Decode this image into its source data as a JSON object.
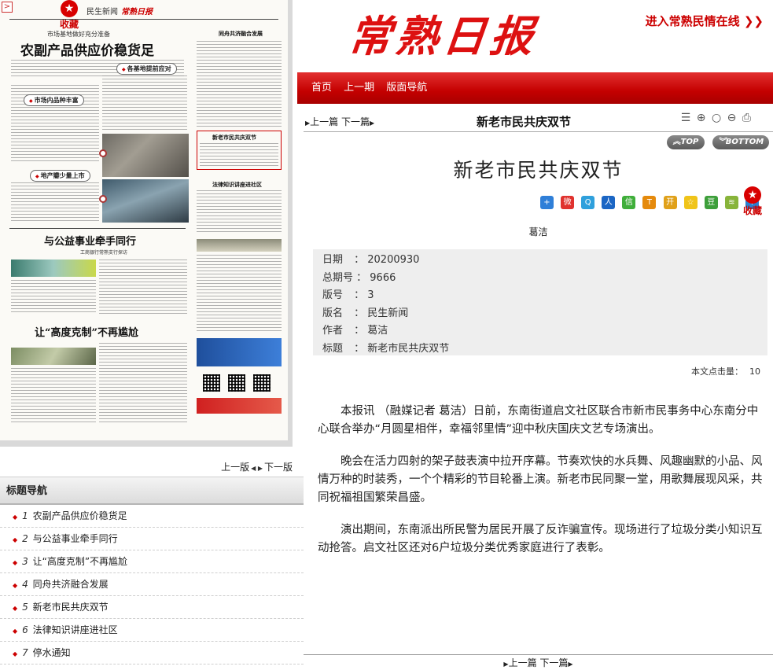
{
  "left": {
    "newspaper": {
      "favorite_label": "收藏",
      "section": "民生新闻",
      "masthead": "常熟日报",
      "headline_main": "农副产品供应价稳货足",
      "kicker_main": "市场基地做好充分准备",
      "sub_supply": "各基地提前应对",
      "sub_market": "市场内品种丰富",
      "sub_local": "地产瓣少量上市",
      "headline_charity": "与公益事业牵手同行",
      "kicker_charity": "工商银行常熟支行探访",
      "headline_myopia": "让“高度克制”不再尴尬",
      "headline_tongzhou": "同舟共济融合发展",
      "headline_festival": "新老市民共庆双节",
      "headline_law": "法律知识讲座进社区",
      "headline_water": "停水通知"
    },
    "pager": {
      "prev": "上一版",
      "next": "下一版"
    },
    "topic_nav": {
      "title": "标题导航",
      "items": [
        {
          "num": "1",
          "label": "农副产品供应价稳货足"
        },
        {
          "num": "2",
          "label": "与公益事业牵手同行"
        },
        {
          "num": "3",
          "label": "让“高度克制”不再尴尬"
        },
        {
          "num": "4",
          "label": "同舟共济融合发展"
        },
        {
          "num": "5",
          "label": "新老市民共庆双节"
        },
        {
          "num": "6",
          "label": "法律知识讲座进社区"
        },
        {
          "num": "7",
          "label": "停水通知"
        }
      ]
    }
  },
  "right": {
    "brand": {
      "logo_text": "常熟日报",
      "external_link": "进入常熟民情在线 ❯❯"
    },
    "nav": {
      "home": "首页",
      "prev_issue": "上一期",
      "layout_nav": "版面导航"
    },
    "article_bar": {
      "prev": "上一篇",
      "next": "下一篇",
      "title": "新老市民共庆双节"
    },
    "top_label": "TOP",
    "bottom_label": "BOTTOM",
    "article": {
      "headline": "新老市民共庆双节",
      "favorite_label": "收藏",
      "author_line": "葛洁",
      "meta": [
        {
          "key": "日期",
          "value": "20200930"
        },
        {
          "key": "总期号",
          "value": "9666"
        },
        {
          "key": "版号",
          "value": "3"
        },
        {
          "key": "版名",
          "value": "民生新闻"
        },
        {
          "key": "作者",
          "value": "葛洁"
        },
        {
          "key": "标题",
          "value": "新老市民共庆双节"
        }
      ],
      "hits_label": "本文点击量：",
      "hits_value": "10",
      "paragraphs": [
        "本报讯 （融媒记者 葛洁）日前，东南街道启文社区联合市新市民事务中心东南分中心联合举办“月圆星相伴，幸福邻里情”迎中秋庆国庆文艺专场演出。",
        "晚会在活力四射的架子鼓表演中拉开序幕。节奏欢快的水兵舞、风趣幽默的小品、风情万种的时装秀，一个个精彩的节目轮番上演。新老市民同聚一堂，用歌舞展现风采，共同祝福祖国繁荣昌盛。",
        "演出期间，东南派出所民警为居民开展了反诈骗宣传。现场进行了垃圾分类小知识互动抢答。启文社区还对6户垃圾分类优秀家庭进行了表彰。"
      ]
    },
    "bottom_nav": {
      "prev": "上一篇",
      "next": "下一篇"
    },
    "icons": {
      "tools": [
        "list-icon",
        "zoom-in-icon",
        "zoom-reset-icon",
        "zoom-out-icon",
        "print-icon"
      ],
      "share": [
        "plus-share-icon",
        "weibo-icon",
        "qzone-icon",
        "renren-icon",
        "wechat-icon",
        "tieba-icon",
        "kaixin-icon",
        "star-share-icon",
        "douban-icon",
        "feed-icon",
        "info-icon"
      ]
    },
    "colors": {
      "brand_red": "#c40000",
      "link_red": "#cc0000"
    }
  }
}
